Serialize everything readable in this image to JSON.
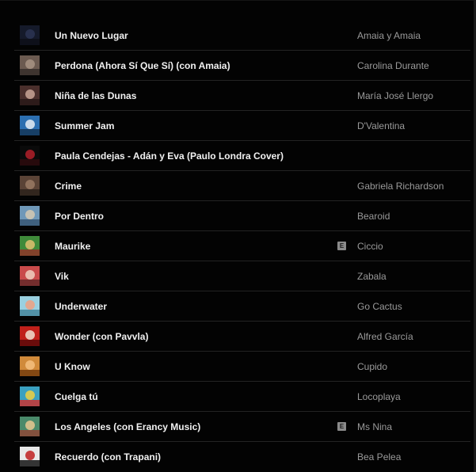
{
  "playlist": {
    "tracks": [
      {
        "title": "Un Nuevo Lugar",
        "artist": "Amaia y Amaia",
        "explicit": false,
        "thumb": {
          "colors": [
            "#151a2a",
            "#2b3554",
            "#0d0f18"
          ]
        }
      },
      {
        "title": "Perdona (Ahora Sí Que Sí) (con Amaia)",
        "artist": "Carolina Durante",
        "explicit": false,
        "thumb": {
          "colors": [
            "#6b5a50",
            "#a89484",
            "#3a302b"
          ]
        }
      },
      {
        "title": "Niña de las Dunas",
        "artist": "María José Llergo",
        "explicit": false,
        "thumb": {
          "colors": [
            "#4a2f2c",
            "#c9a496",
            "#2a1a18"
          ]
        }
      },
      {
        "title": "Summer Jam",
        "artist": "D'Valentina",
        "explicit": false,
        "thumb": {
          "colors": [
            "#2c6fb0",
            "#e8eef5",
            "#153a5e"
          ]
        }
      },
      {
        "title": "Paula Cendejas - Adán y Eva (Paulo Londra Cover)",
        "artist": "",
        "explicit": false,
        "thumb": {
          "colors": [
            "#0a0a0a",
            "#b3202a",
            "#2a0a0c"
          ]
        }
      },
      {
        "title": "Crime",
        "artist": "Gabriela Richardson",
        "explicit": false,
        "thumb": {
          "colors": [
            "#5a4336",
            "#9a7a64",
            "#2e231c"
          ]
        }
      },
      {
        "title": "Por Dentro",
        "artist": "Bearoid",
        "explicit": false,
        "thumb": {
          "colors": [
            "#6f98b8",
            "#d6c9b2",
            "#3a5a78"
          ]
        }
      },
      {
        "title": "Maurike",
        "artist": "Ciccio",
        "explicit": true,
        "explicit_label": "E",
        "thumb": {
          "colors": [
            "#3f8a3a",
            "#e0c070",
            "#8a3a2a"
          ]
        }
      },
      {
        "title": "Vik",
        "artist": "Zabala",
        "explicit": false,
        "thumb": {
          "colors": [
            "#c94a4a",
            "#f0d0c0",
            "#6a2a2a"
          ]
        }
      },
      {
        "title": "Underwater",
        "artist": "Go Cactus",
        "explicit": false,
        "thumb": {
          "colors": [
            "#9ad0e0",
            "#f0a080",
            "#4a8aa0"
          ]
        }
      },
      {
        "title": "Wonder (con Pavvla)",
        "artist": "Alfred García",
        "explicit": false,
        "thumb": {
          "colors": [
            "#c0201a",
            "#f0e0d0",
            "#600a0a"
          ]
        }
      },
      {
        "title": "U Know",
        "artist": "Cupido",
        "explicit": false,
        "thumb": {
          "colors": [
            "#d08a3a",
            "#f5c080",
            "#7a4010"
          ]
        }
      },
      {
        "title": "Cuelga tú",
        "artist": "Locoplaya",
        "explicit": false,
        "thumb": {
          "colors": [
            "#3aa0c0",
            "#f0d040",
            "#c03a3a"
          ]
        }
      },
      {
        "title": "Los Angeles (con Erancy Music)",
        "artist": "Ms Nina",
        "explicit": true,
        "explicit_label": "E",
        "thumb": {
          "colors": [
            "#4a8a6a",
            "#e8c890",
            "#8a4a3a"
          ]
        }
      },
      {
        "title": "Recuerdo (con Trapani)",
        "artist": "Bea Pelea",
        "explicit": false,
        "thumb": {
          "colors": [
            "#e8e8e8",
            "#c02020",
            "#202020"
          ]
        }
      }
    ]
  },
  "theme": {
    "background": "#030303",
    "divider": "#232323",
    "title_color": "#f1f1f1",
    "artist_color": "#9a9a9a"
  }
}
